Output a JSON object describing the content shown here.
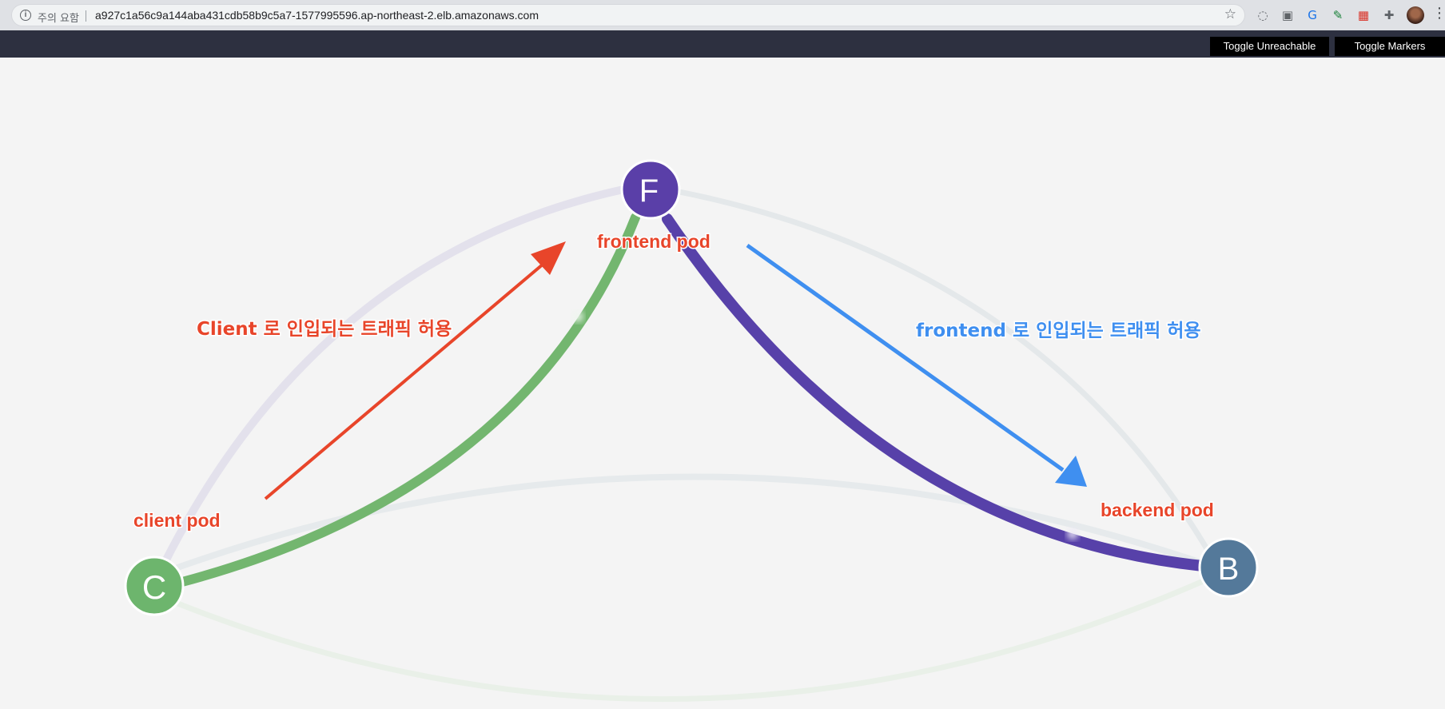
{
  "browser": {
    "security_label": "주의 요함",
    "url": "a927c1a56c9a144aba431cdb58b9c5a7-1577995596.ap-northeast-2.elb.amazonaws.com",
    "info_icon": "i",
    "star_icon": "☆",
    "extensions": [
      "◌",
      "▣",
      "G",
      "✎",
      "▦",
      "✚"
    ],
    "menu_icon": "⋮"
  },
  "toolbar": {
    "toggle_unreachable": "Toggle Unreachable",
    "toggle_markers": "Toggle Markers"
  },
  "graph": {
    "nodes": {
      "client": {
        "letter": "C",
        "color": "#6db56d"
      },
      "frontend": {
        "letter": "F",
        "color": "#5a3fa8"
      },
      "backend": {
        "letter": "B",
        "color": "#54799a"
      }
    },
    "annotations": {
      "client_pod": "client pod",
      "frontend_pod": "frontend pod",
      "backend_pod": "backend pod",
      "client_ingress": "Client 로 인입되는 트래픽 허용",
      "frontend_ingress": "frontend 로 인입되는 트래픽 허용"
    },
    "colors": {
      "client_link": "#73b66f",
      "frontend_link": "#5741a9",
      "red_arrow": "#e8452a",
      "blue_arrow": "#3f8ff0",
      "red_text": "#e8452a",
      "blue_text": "#3f8ff0"
    }
  }
}
